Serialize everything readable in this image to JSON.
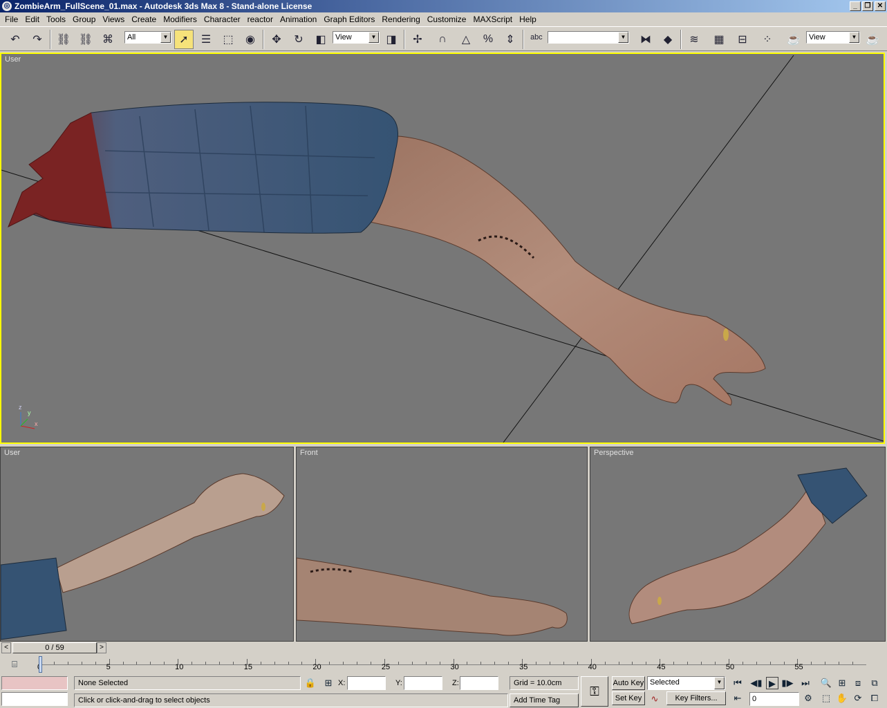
{
  "window": {
    "title": "ZombieArm_FullScene_01.max - Autodesk 3ds Max 8  - Stand-alone License",
    "app_icon": "3ds-max-icon"
  },
  "menu": [
    "File",
    "Edit",
    "Tools",
    "Group",
    "Views",
    "Create",
    "Modifiers",
    "Character",
    "reactor",
    "Animation",
    "Graph Editors",
    "Rendering",
    "Customize",
    "MAXScript",
    "Help"
  ],
  "toolbar": {
    "selection_filter": "All",
    "ref_coord_system": "View",
    "named_selection_set": "",
    "render_view": "View"
  },
  "viewports": {
    "main": {
      "label": "User"
    },
    "bottom_left": {
      "label": "User"
    },
    "bottom_center": {
      "label": "Front"
    },
    "bottom_right": {
      "label": "Perspective"
    },
    "axis_x": "x",
    "axis_y": "y",
    "axis_z": "z"
  },
  "timeline": {
    "frame_display": "0 / 59",
    "ticks": [
      "0",
      "5",
      "10",
      "15",
      "20",
      "25",
      "30",
      "35",
      "40",
      "45",
      "50",
      "55"
    ],
    "current_frame": 0,
    "total_frames": 59
  },
  "status": {
    "selection": "None Selected",
    "prompt": "Click or click-and-drag to select objects",
    "x_label": "X:",
    "y_label": "Y:",
    "z_label": "Z:",
    "x_value": "",
    "y_value": "",
    "z_value": "",
    "grid": "Grid = 10.0cm",
    "add_time_tag": "Add Time Tag",
    "auto_key": "Auto Key",
    "set_key": "Set Key",
    "key_mode": "Selected",
    "key_filters": "Key Filters...",
    "current_frame_field": "0"
  },
  "colors": {
    "title_start": "#0a246a",
    "title_end": "#a6caf0",
    "active_border": "#ffff00",
    "viewport_bg": "#777777",
    "sleeve": "#3e5b7c",
    "skin": "#b58a78"
  }
}
